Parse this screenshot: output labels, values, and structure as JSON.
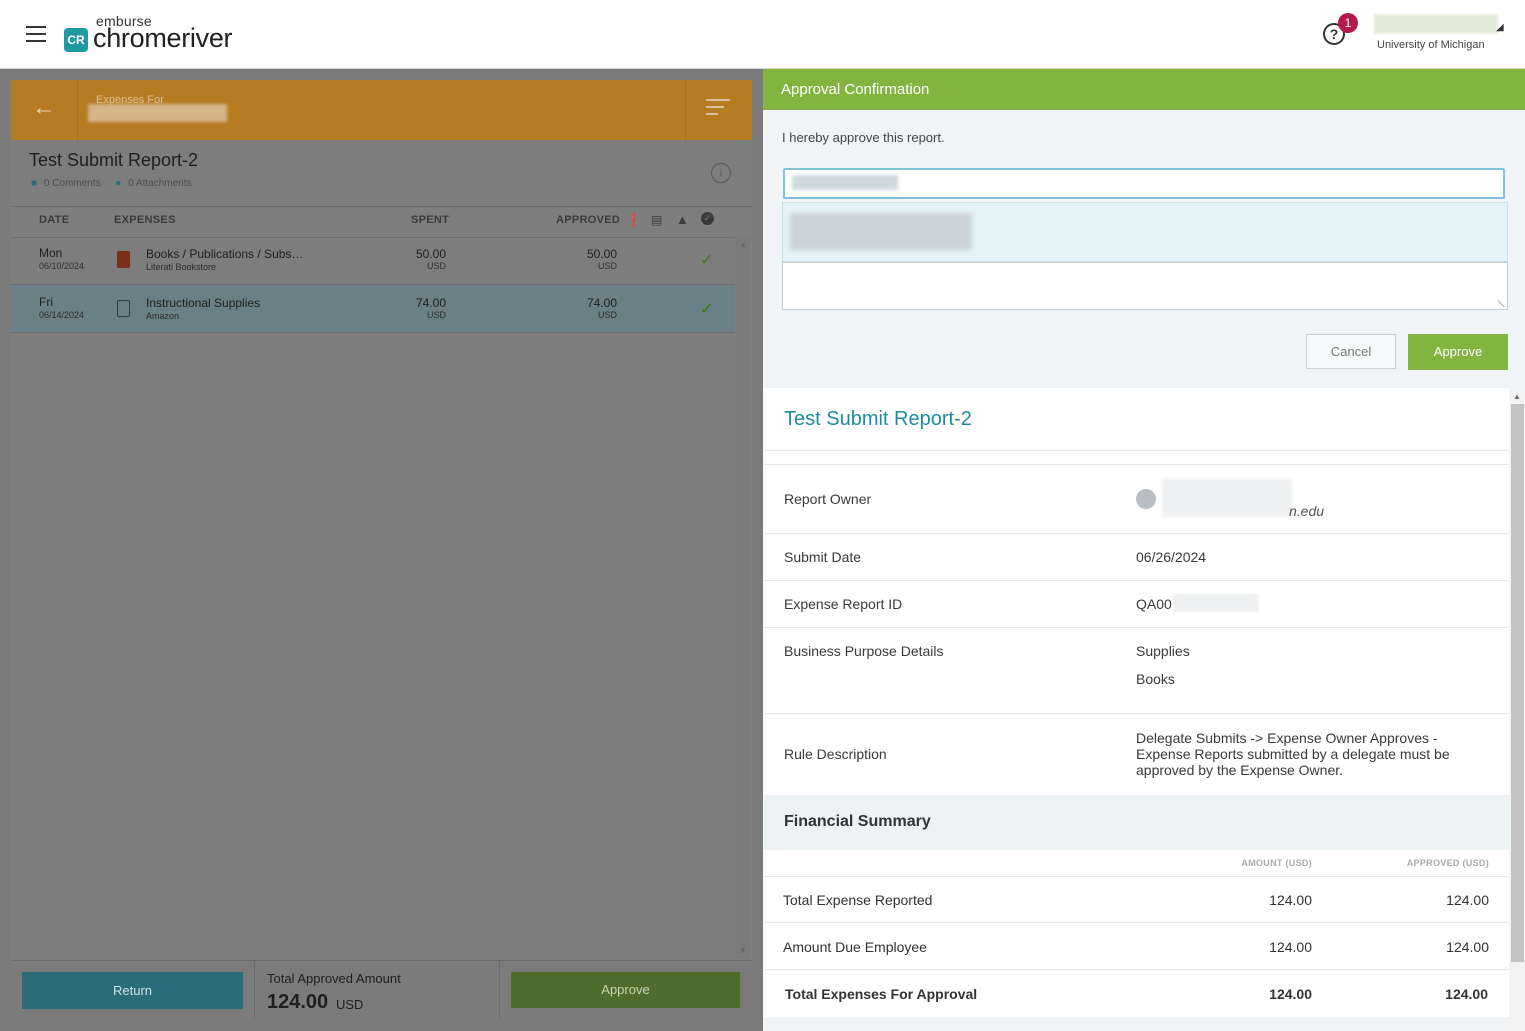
{
  "header": {
    "logo_top": "emburse",
    "logo_main": "chromeriver",
    "logo_mark": "CR",
    "help_badge": "1",
    "org": "University of Michigan"
  },
  "left": {
    "expenses_for": "Expenses For",
    "report_title": "Test Submit Report-2",
    "comments": "0 Comments",
    "attachments": "0 Attachments",
    "columns": {
      "date": "DATE",
      "expenses": "EXPENSES",
      "spent": "SPENT",
      "approved": "APPROVED"
    },
    "rows": [
      {
        "day": "Mon",
        "date": "06/10/2024",
        "name": "Books / Publications / Subs…",
        "vendor": "Literati Bookstore",
        "spent": "50.00",
        "spent_cur": "USD",
        "approved": "50.00",
        "approved_cur": "USD"
      },
      {
        "day": "Fri",
        "date": "06/14/2024",
        "name": "Instructional Supplies",
        "vendor": "Amazon",
        "spent": "74.00",
        "spent_cur": "USD",
        "approved": "74.00",
        "approved_cur": "USD"
      }
    ],
    "return_label": "Return",
    "total_label": "Total Approved Amount",
    "total_value": "124.00",
    "total_currency": "USD",
    "approve_label": "Approve"
  },
  "right": {
    "title": "Approval Confirmation",
    "statement": "I hereby approve this report.",
    "cancel_label": "Cancel",
    "approve_label": "Approve",
    "report_title": "Test Submit Report-2",
    "details": {
      "owner_label": "Report Owner",
      "owner_value_visible": "n.edu",
      "submit_label": "Submit Date",
      "submit_value": "06/26/2024",
      "id_label": "Expense Report ID",
      "id_value_visible": "QA00",
      "purpose_label": "Business Purpose Details",
      "purpose_values": [
        "Supplies",
        "Books"
      ],
      "rule_label": "Rule Description",
      "rule_value": "Delegate Submits -> Expense Owner Approves - Expense Reports submitted by a delegate must be approved by the Expense Owner."
    },
    "financial": {
      "title": "Financial Summary",
      "col_amount": "AMOUNT (USD)",
      "col_approved": "APPROVED (USD)",
      "rows": [
        {
          "label": "Total Expense Reported",
          "amount": "124.00",
          "approved": "124.00"
        },
        {
          "label": "Amount Due Employee",
          "amount": "124.00",
          "approved": "124.00"
        },
        {
          "label": "Total Expenses For Approval",
          "amount": "124.00",
          "approved": "124.00"
        }
      ]
    }
  }
}
